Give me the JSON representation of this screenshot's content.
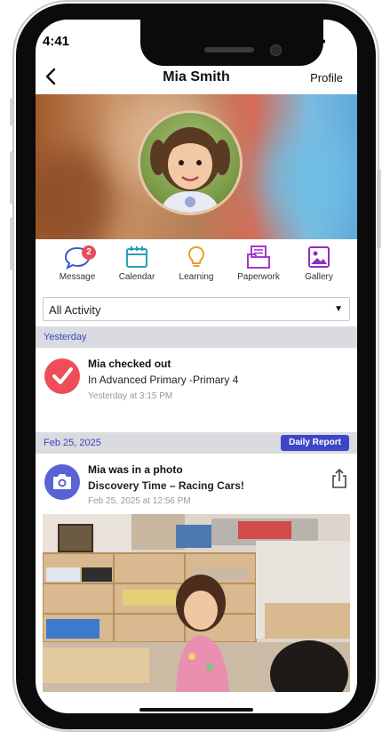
{
  "status": {
    "time": "4:41"
  },
  "nav": {
    "back": "‹",
    "title": "Mia Smith",
    "profile": "Profile"
  },
  "actions": [
    {
      "label": "Message",
      "icon": "message-icon",
      "badge": "2"
    },
    {
      "label": "Calendar",
      "icon": "calendar-icon"
    },
    {
      "label": "Learning",
      "icon": "lightbulb-icon"
    },
    {
      "label": "Paperwork",
      "icon": "folder-icon"
    },
    {
      "label": "Gallery",
      "icon": "gallery-icon"
    }
  ],
  "filter": {
    "value": "All Activity",
    "arrow": "▼"
  },
  "feed": [
    {
      "date": "Yesterday",
      "title": "Mia checked out",
      "subtitle": "In Advanced Primary -Primary 4",
      "time": "Yesterday at 3:15 PM",
      "icon": "checkmark-icon"
    },
    {
      "date": "Feb 25, 2025",
      "badge": "Daily Report",
      "title": "Mia was in a photo",
      "subtitle": "Discovery Time – Racing Cars!",
      "time": "Feb 25, 2025 at 12:56 PM",
      "icon": "camera-icon"
    }
  ],
  "colors": {
    "accent": "#3d46c8",
    "checkout": "#ef4d59",
    "photo": "#5963d6",
    "section": "#d9dbe0"
  }
}
